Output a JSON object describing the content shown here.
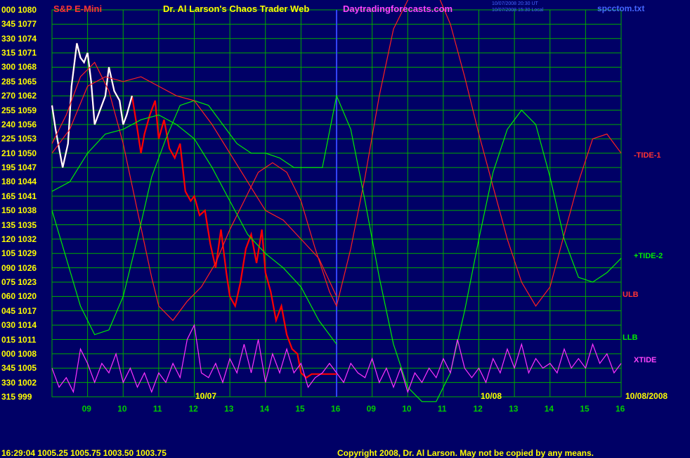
{
  "header": {
    "instrument": "S&P E-Mini",
    "title": "Dr. Al Larson's Chaos Trader Web",
    "site": "Daytradingforecasts.com",
    "time_line1": "10/07/2008 20:30 UT",
    "time_line2": "10/07/2008 15:30 Local",
    "file": "spcctom.txt"
  },
  "footer": {
    "quote": "16:29:04  1005.25  1005.75  1003.50  1003.75",
    "copyright": "Copyright 2008, Dr. Al Larson. May not be copied by any means."
  },
  "colors": {
    "background": "#000066",
    "grid": "#00aa00",
    "price_up": "#ffffff",
    "price_down": "#ff0000",
    "tide1": "#ff2020",
    "tide2": "#00ee00",
    "xtide": "#ff33ff",
    "avg": "#ffff00",
    "blue": "#3344ff"
  },
  "chart_data": {
    "type": "line",
    "title": "S&P E-Mini",
    "ylim": [
      999,
      1080
    ],
    "y_ticks": [
      {
        "angle": "000",
        "price": "1080"
      },
      {
        "angle": "345",
        "price": "1077"
      },
      {
        "angle": "330",
        "price": "1074"
      },
      {
        "angle": "315",
        "price": "1071"
      },
      {
        "angle": "300",
        "price": "1068"
      },
      {
        "angle": "285",
        "price": "1065"
      },
      {
        "angle": "270",
        "price": "1062"
      },
      {
        "angle": "255",
        "price": "1059"
      },
      {
        "angle": "240",
        "price": "1056"
      },
      {
        "angle": "225",
        "price": "1053"
      },
      {
        "angle": "210",
        "price": "1050"
      },
      {
        "angle": "195",
        "price": "1047"
      },
      {
        "angle": "180",
        "price": "1044"
      },
      {
        "angle": "165",
        "price": "1041"
      },
      {
        "angle": "150",
        "price": "1038"
      },
      {
        "angle": "135",
        "price": "1035"
      },
      {
        "angle": "120",
        "price": "1032"
      },
      {
        "angle": "105",
        "price": "1029"
      },
      {
        "angle": "090",
        "price": "1026"
      },
      {
        "angle": "075",
        "price": "1023"
      },
      {
        "angle": "060",
        "price": "1020"
      },
      {
        "angle": "045",
        "price": "1017"
      },
      {
        "angle": "030",
        "price": "1014"
      },
      {
        "angle": "015",
        "price": "1011"
      },
      {
        "angle": "000",
        "price": "1008"
      },
      {
        "angle": "345",
        "price": "1005"
      },
      {
        "angle": "330",
        "price": "1002"
      },
      {
        "angle": "315",
        "price": "999"
      }
    ],
    "x_ticks": [
      "09",
      "10",
      "11",
      "12",
      "13",
      "14",
      "15",
      "16",
      "09",
      "10",
      "11",
      "12",
      "13",
      "14",
      "15",
      "16"
    ],
    "date_labels": [
      "10/07",
      "10/08",
      "10/08/2008"
    ],
    "series_labels": [
      "-TIDE-1",
      "+TIDE-2",
      "ULB",
      "LLB",
      "XTIDE"
    ],
    "series": [
      {
        "name": "price",
        "x": [
          8.0,
          8.1,
          8.2,
          8.3,
          8.45,
          8.55,
          8.7,
          8.8,
          8.9,
          9.0,
          9.1,
          9.2,
          9.35,
          9.5,
          9.6,
          9.75,
          9.9,
          10.0,
          10.1,
          10.25,
          10.4,
          10.5,
          10.6,
          10.75,
          10.9,
          11.0,
          11.15,
          11.3,
          11.45,
          11.6,
          11.75,
          11.9,
          12.0,
          12.15,
          12.3,
          12.45,
          12.6,
          12.75,
          12.9,
          13.0,
          13.15,
          13.3,
          13.45,
          13.6,
          13.75,
          13.9,
          14.0,
          14.15,
          14.3,
          14.45,
          14.6,
          14.75,
          14.9,
          15.0,
          15.15,
          15.3,
          15.45,
          15.6,
          15.75,
          15.9,
          16.0
        ],
        "y": [
          1060,
          1055,
          1051,
          1047,
          1052,
          1064,
          1073,
          1070,
          1069,
          1071,
          1065,
          1056,
          1059,
          1062,
          1068,
          1063,
          1061,
          1056,
          1058,
          1062,
          1055,
          1050,
          1054,
          1058,
          1061,
          1053,
          1057,
          1051,
          1049,
          1052,
          1042,
          1040,
          1041,
          1037,
          1038,
          1031,
          1026,
          1034,
          1025,
          1020,
          1018,
          1023,
          1030,
          1033,
          1027,
          1034,
          1025,
          1021,
          1015,
          1018,
          1012,
          1009,
          1008,
          1004,
          1003,
          1003.75,
          1003.75,
          1003.75,
          1003.75,
          1003.75,
          1003.75
        ]
      },
      {
        "name": "-TIDE-1",
        "x": [
          8.0,
          8.4,
          8.8,
          9.2,
          9.6,
          10.0,
          10.4,
          10.8,
          11.0,
          11.4,
          11.8,
          12.2,
          12.6,
          13.0,
          13.4,
          13.8,
          14.2,
          14.6,
          15.0,
          15.4,
          15.8,
          16.0,
          16.4,
          16.8,
          17.2,
          17.6,
          18.0,
          18.4,
          18.8,
          19.2,
          19.6,
          20.0,
          20.4,
          20.8,
          21.2,
          21.6,
          22.0,
          22.4,
          22.8,
          23.2,
          23.6,
          24.0
        ],
        "y": [
          1052,
          1058,
          1066,
          1069,
          1063,
          1052,
          1038,
          1024,
          1018,
          1015,
          1019,
          1022,
          1027,
          1034,
          1040,
          1046,
          1048,
          1046,
          1040,
          1030,
          1021,
          1018,
          1030,
          1045,
          1062,
          1076,
          1082,
          1086,
          1084,
          1077,
          1066,
          1054,
          1043,
          1032,
          1023,
          1018,
          1022,
          1033,
          1044,
          1053,
          1054,
          1050
        ]
      },
      {
        "name": "+TIDE-2",
        "x": [
          8.0,
          8.4,
          8.8,
          9.2,
          9.6,
          10.0,
          10.4,
          10.8,
          11.2,
          11.6,
          12.0,
          12.4,
          12.8,
          13.2,
          13.6,
          14.0,
          14.4,
          14.8,
          15.2,
          15.6,
          16.0,
          16.4,
          16.8,
          17.2,
          17.6,
          18.0,
          18.4,
          18.8,
          19.2,
          19.6,
          20.0,
          20.4,
          20.8,
          21.2,
          21.6,
          22.0,
          22.4,
          22.8,
          23.2,
          23.6,
          24.0
        ],
        "y": [
          1038,
          1028,
          1018,
          1012,
          1013,
          1020,
          1032,
          1045,
          1053,
          1060,
          1061,
          1060,
          1056,
          1052,
          1050,
          1050,
          1049,
          1047,
          1047,
          1047,
          1062,
          1055,
          1040,
          1024,
          1010,
          1001,
          998,
          998,
          1004,
          1017,
          1032,
          1046,
          1055,
          1059,
          1056,
          1045,
          1032,
          1024,
          1023,
          1025,
          1028
        ]
      },
      {
        "name": "ULB",
        "x": [
          8.0,
          8.5,
          9.0,
          9.5,
          10.0,
          10.5,
          11.0,
          11.5,
          12.0,
          12.5,
          13.0,
          13.5,
          14.0,
          14.5,
          15.0,
          15.5,
          16.0
        ],
        "y": [
          1050,
          1055,
          1064,
          1066,
          1065,
          1066,
          1064,
          1062,
          1061,
          1056,
          1050,
          1044,
          1038,
          1036,
          1032,
          1028,
          1020
        ]
      },
      {
        "name": "LLB",
        "x": [
          8.0,
          8.5,
          9.0,
          9.5,
          10.0,
          10.5,
          11.0,
          11.5,
          12.0,
          12.5,
          13.0,
          13.5,
          14.0,
          14.5,
          15.0,
          15.5,
          16.0
        ],
        "y": [
          1042,
          1044,
          1050,
          1054,
          1055,
          1057,
          1058,
          1056,
          1053,
          1047,
          1040,
          1033,
          1029,
          1026,
          1022,
          1015,
          1010
        ]
      },
      {
        "name": "XTIDE",
        "x": [
          8.0,
          8.2,
          8.4,
          8.6,
          8.8,
          9.0,
          9.2,
          9.4,
          9.6,
          9.8,
          10.0,
          10.2,
          10.4,
          10.6,
          10.8,
          11.0,
          11.2,
          11.4,
          11.6,
          11.8,
          12.0,
          12.2,
          12.4,
          12.6,
          12.8,
          13.0,
          13.2,
          13.4,
          13.6,
          13.8,
          14.0,
          14.2,
          14.4,
          14.6,
          14.8,
          15.0,
          15.2,
          15.4,
          15.6,
          15.8,
          16.0,
          16.2,
          16.4,
          16.6,
          16.8,
          17.0,
          17.2,
          17.4,
          17.6,
          17.8,
          18.0,
          18.2,
          18.4,
          18.6,
          18.8,
          19.0,
          19.2,
          19.4,
          19.6,
          19.8,
          20.0,
          20.2,
          20.4,
          20.6,
          20.8,
          21.0,
          21.2,
          21.4,
          21.6,
          21.8,
          22.0,
          22.2,
          22.4,
          22.6,
          22.8,
          23.0,
          23.2,
          23.4,
          23.6,
          23.8,
          24.0
        ],
        "y": [
          1005,
          1001,
          1003,
          1000,
          1009,
          1006,
          1002,
          1006,
          1004,
          1008,
          1002,
          1005,
          1001,
          1004,
          1000,
          1004,
          1002,
          1006,
          1003,
          1011,
          1014,
          1004,
          1003,
          1006,
          1002,
          1007,
          1004,
          1010,
          1004,
          1011,
          1002,
          1008,
          1004,
          1009,
          1004,
          1006,
          1001,
          1003,
          1004,
          1006,
          1004,
          1002,
          1006,
          1004,
          1003,
          1007,
          1002,
          1005,
          1001,
          1005,
          1000,
          1004,
          1002,
          1005,
          1003,
          1007,
          1004,
          1011,
          1005,
          1003,
          1005,
          1002,
          1007,
          1004,
          1009,
          1005,
          1010,
          1004,
          1007,
          1005,
          1006,
          1004,
          1009,
          1005,
          1007,
          1005,
          1010,
          1006,
          1008,
          1004,
          1006
        ]
      }
    ]
  }
}
